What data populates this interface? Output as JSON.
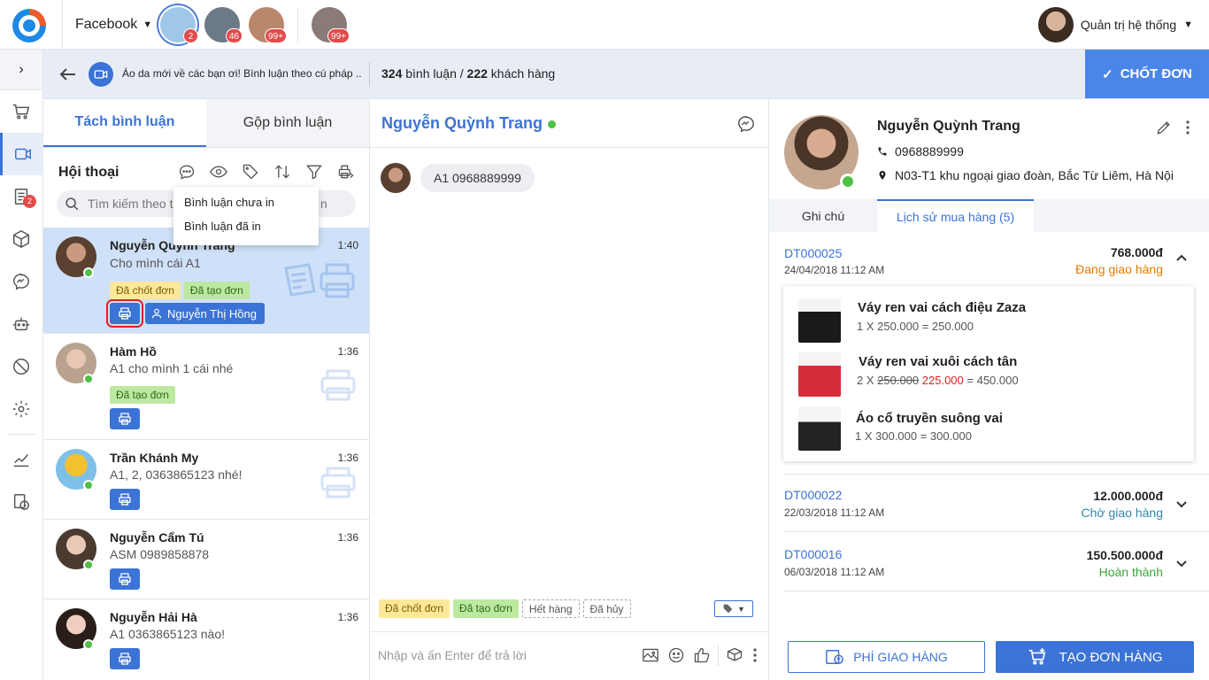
{
  "topbar": {
    "channel": "Facebook",
    "user_name": "Quản trị hệ thống",
    "pages": [
      {
        "badge": "2"
      },
      {
        "badge": "46"
      },
      {
        "badge": "99+"
      },
      {
        "badge": "99+"
      }
    ]
  },
  "sidebar": {
    "toggle": "›",
    "orders_badge": "2"
  },
  "subbar": {
    "post_title": "Áo da mới về các bạn ơi! Bình luận theo cú pháp ...",
    "comment_count": "324",
    "comment_word": "bình luận /",
    "customer_count": "222",
    "customer_word": "khách hàng",
    "confirm_label": "CHỐT ĐƠN"
  },
  "left": {
    "tabs": {
      "split": "Tách bình luận",
      "merge": "Gộp bình luận"
    },
    "heading": "Hội thoại",
    "search_placeholder": "Tìm kiếm theo t",
    "search_tail": "n",
    "dropdown": [
      "Bình luận chưa in",
      "Bình luận đã in"
    ],
    "conversations": [
      {
        "name": "Nguyễn Quỳnh Trang",
        "time": "1:40",
        "msg": "Cho mình cái A1",
        "tags": [
          "Đã chốt đơn",
          "Đã tạo đơn"
        ],
        "staff": "Nguyễn Thị Hồng"
      },
      {
        "name": "Hàm Hồ",
        "time": "1:36",
        "msg": "A1 cho mình 1 cái nhé",
        "tags": [
          "Đã tạo đơn"
        ]
      },
      {
        "name": "Trần Khánh My",
        "time": "1:36",
        "msg": "A1, 2, 0363865123 nhé!"
      },
      {
        "name": "Nguyễn Cẩm Tú",
        "time": "1:36",
        "msg": "ASM 0989858878"
      },
      {
        "name": "Nguyễn Hải Hà",
        "time": "1:36",
        "msg": "A1 0363865123 nào!"
      }
    ]
  },
  "chat": {
    "name": "Nguyễn Quỳnh Trang",
    "message": "A1 0968889999",
    "tags": [
      "Đã chốt đơn",
      "Đã tạo đơn",
      "Hết hàng",
      "Đã hủy"
    ],
    "placeholder": "Nhập và ấn Enter để trả lời"
  },
  "customer": {
    "name": "Nguyễn Quỳnh Trang",
    "phone": "0968889999",
    "address": "N03-T1 khu ngoại giao đoàn, Bắc Từ Liêm, Hà Nội",
    "tabs": {
      "notes": "Ghi chú",
      "history": "Lịch sử mua hàng (5)"
    },
    "orders": [
      {
        "code": "DT000025",
        "date": "24/04/2018 11:12 AM",
        "amount": "768.000đ",
        "status": "Đang giao hàng",
        "status_color": "#e07b00",
        "items": [
          {
            "name": "Váy ren vai cách điệu Zaza",
            "qty": "1 X 250.000 = 250.000"
          },
          {
            "name": "Váy ren vai xuôi cách tân",
            "qty_prefix": "2 X",
            "old_price": "250.000",
            "new_price": "225.000",
            "qty_suffix": "= 450.000"
          },
          {
            "name": "Áo cổ truyền suông vai",
            "qty": "1 X 300.000 = 300.000"
          }
        ]
      },
      {
        "code": "DT000022",
        "date": "22/03/2018 11:12 AM",
        "amount": "12.000.000đ",
        "status": "Chờ giao hàng",
        "status_color": "#2a8ab0"
      },
      {
        "code": "DT000016",
        "date": "06/03/2018 11:12 AM",
        "amount": "150.500.000đ",
        "status": "Hoàn thành",
        "status_color": "#3aa63a"
      }
    ],
    "ship_fee_label": "PHÍ GIAO HÀNG",
    "create_order_label": "TẠO ĐƠN HÀNG"
  },
  "colors": {
    "primary": "#3b73d6",
    "confirm": "#4a86e8",
    "online": "#4fc046",
    "badge": "#e34b4b"
  }
}
